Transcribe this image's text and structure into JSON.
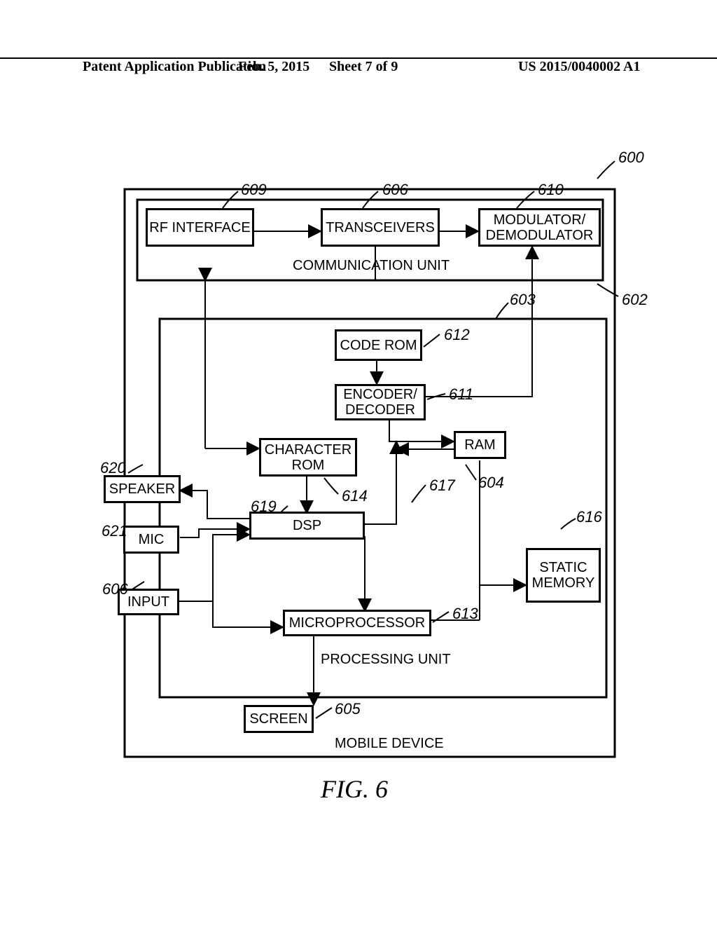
{
  "header": {
    "left": "Patent Application Publication",
    "center": "Feb. 5, 2015",
    "sheet": "Sheet 7 of 9",
    "number": "US 2015/0040002 A1"
  },
  "blocks": {
    "rf_interface": "RF INTERFACE",
    "transceivers": "TRANSCEIVERS",
    "modulator": "MODULATOR/\nDEMODULATOR",
    "code_rom": "CODE ROM",
    "encoder": "ENCODER/\nDECODER",
    "char_rom": "CHARACTER\nROM",
    "ram": "RAM",
    "speaker": "SPEAKER",
    "dsp": "DSP",
    "mic": "MIC",
    "static_mem": "STATIC\nMEMORY",
    "input": "INPUT",
    "microprocessor": "MICROPROCESSOR",
    "screen": "SCREEN"
  },
  "labels": {
    "comm_unit": "COMMUNICATION UNIT",
    "proc_unit": "PROCESSING UNIT",
    "mobile_device": "MOBILE DEVICE"
  },
  "refs": {
    "r600": "600",
    "r602": "602",
    "r603": "603",
    "r604": "604",
    "r605": "605",
    "r606a": "606",
    "r606b": "606",
    "r609": "609",
    "r610": "610",
    "r611": "611",
    "r612": "612",
    "r613": "613",
    "r614": "614",
    "r616": "616",
    "r617": "617",
    "r619": "619",
    "r620": "620",
    "r621": "621"
  },
  "figure_caption": "FIG. 6"
}
